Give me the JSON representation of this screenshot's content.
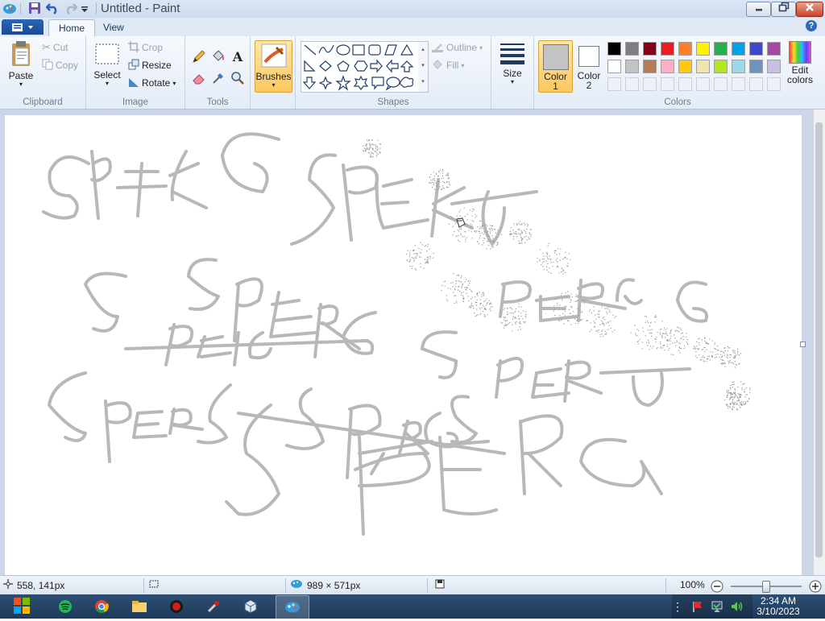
{
  "window": {
    "title": "Untitled - Paint"
  },
  "tabs": {
    "home": "Home",
    "view": "View"
  },
  "help_icon": "?",
  "clipboard": {
    "paste": "Paste",
    "cut": "Cut",
    "copy": "Copy",
    "group_label": "Clipboard"
  },
  "image": {
    "select": "Select",
    "crop": "Crop",
    "resize": "Resize",
    "rotate": "Rotate",
    "group_label": "Image"
  },
  "tools": {
    "group_label": "Tools",
    "text_tool_glyph": "A"
  },
  "brushes": {
    "label": "Brushes"
  },
  "shapes": {
    "outline": "Outline",
    "fill": "Fill",
    "group_label": "Shapes"
  },
  "size": {
    "label": "Size"
  },
  "color1": {
    "label_line1": "Color",
    "label_line2": "1",
    "value": "#c3c3c3"
  },
  "color2": {
    "label_line1": "Color",
    "label_line2": "2",
    "value": "#ffffff"
  },
  "colors": {
    "group_label": "Colors",
    "edit_line1": "Edit",
    "edit_line2": "colors",
    "row1": [
      "#000000",
      "#7f7f7f",
      "#880015",
      "#ed1c24",
      "#ff7f27",
      "#fff200",
      "#22b14c",
      "#00a2e8",
      "#3f48cc",
      "#a349a4"
    ],
    "row2": [
      "#ffffff",
      "#c3c3c3",
      "#b97a57",
      "#ffaec9",
      "#ffc90e",
      "#efe4b0",
      "#b5e61d",
      "#99d9ea",
      "#7092be",
      "#c8bfe7"
    ]
  },
  "status": {
    "cursor_pos": "558, 141px",
    "selection_size": "",
    "image_size": "989 × 571px",
    "zoom": "100%"
  },
  "clock": {
    "time": "2:34 AM",
    "date": "3/10/2023"
  },
  "stroke_color": "#b8b8b8"
}
